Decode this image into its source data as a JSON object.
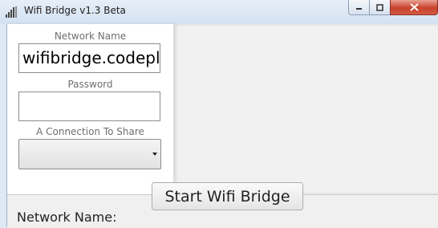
{
  "window": {
    "title": "Wifi Bridge v1.3 Beta",
    "app_icon": "signal-bars-icon",
    "controls": [
      "minimize-icon",
      "maximize-icon",
      "close-icon"
    ]
  },
  "form": {
    "network_name_label": "Network Name",
    "network_name_value": "wifibridge.codeple",
    "password_label": "Password",
    "password_value": "",
    "connection_label": "A Connection To Share",
    "connection_value": ""
  },
  "actions": {
    "start_label": "Start Wifi Bridge"
  },
  "status": {
    "network_name_label": "Network Name:"
  },
  "colors": {
    "title_bar": "#dde9f6",
    "close_button": "#c8412c",
    "client_background": "#f0f0f0"
  }
}
